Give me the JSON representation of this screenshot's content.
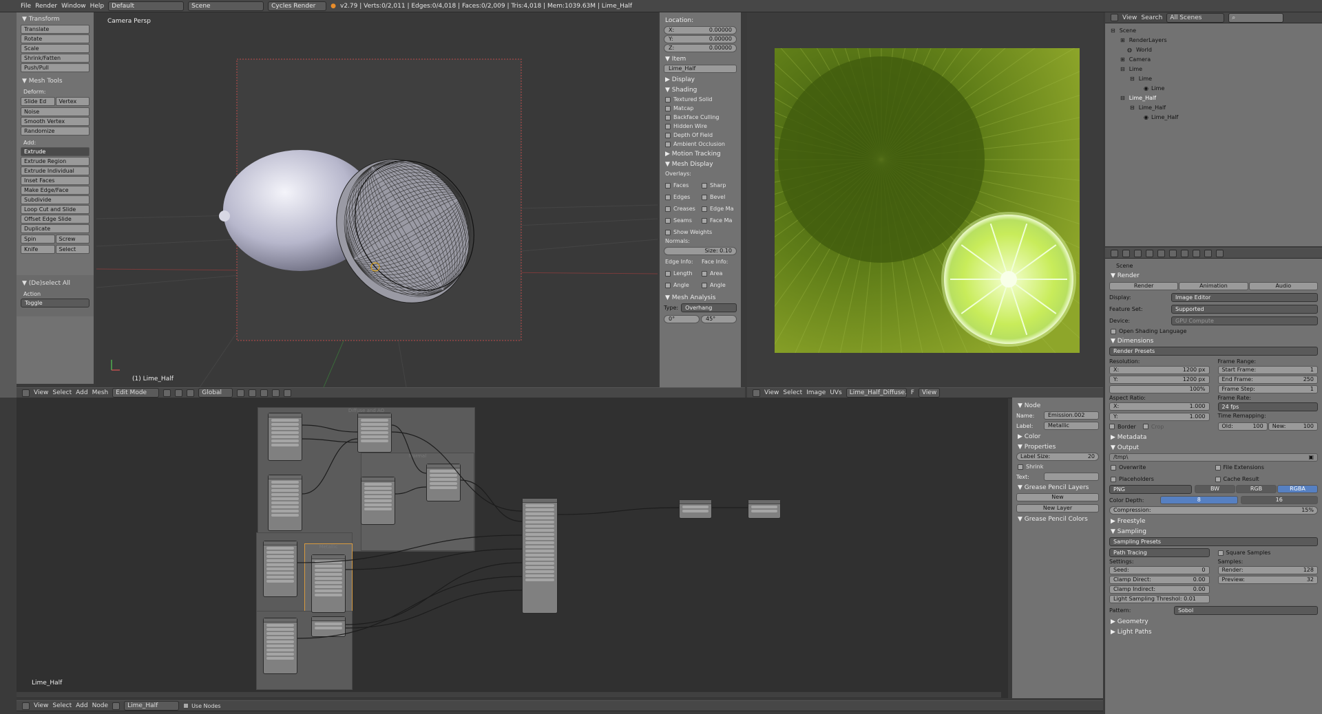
{
  "topbar": {
    "menus": [
      "File",
      "Render",
      "Window",
      "Help"
    ],
    "layout": "Default",
    "scene": "Scene",
    "engine": "Cycles Render",
    "stats": "v2.79 | Verts:0/2,011 | Edges:0/4,018 | Faces:0/2,009 | Tris:4,018 | Mem:1039.63M | Lime_Half"
  },
  "tools": {
    "transform_title": "Transform",
    "transform_buttons": [
      "Translate",
      "Rotate",
      "Scale",
      "Shrink/Fatten",
      "Push/Pull"
    ],
    "mesh_title": "Mesh Tools",
    "deform_label": "Deform:",
    "slide_edge": "Slide Ed",
    "vertex": "Vertex",
    "deform_buttons": [
      "Noise",
      "Smooth Vertex",
      "Randomize"
    ],
    "add_label": "Add:",
    "extrude": "Extrude",
    "add_buttons": [
      "Extrude Region",
      "Extrude Individual",
      "Inset Faces",
      "Make Edge/Face",
      "Subdivide",
      "Loop Cut and Slide",
      "Offset Edge Slide",
      "Duplicate"
    ],
    "spin": "Spin",
    "screw": "Screw",
    "knife": "Knife",
    "select": "Select",
    "deselect_all": "(De)select All",
    "action_label": "Action",
    "action_value": "Toggle"
  },
  "viewport": {
    "title": "Camera Persp",
    "object": "(1) Lime_Half",
    "header_menus": [
      "View",
      "Select",
      "Add",
      "Mesh"
    ],
    "mode": "Edit Mode",
    "orientation": "Global"
  },
  "npanel": {
    "location_title": "Location:",
    "x": "X:",
    "x_val": "0.00000",
    "y": "Y:",
    "y_val": "0.00000",
    "z": "Z:",
    "z_val": "0.00000",
    "item_title": "Item",
    "item_name": "Lime_Half",
    "display": "Display",
    "shading": "Shading",
    "shading_checks": [
      "Textured Solid",
      "Matcap",
      "Backface Culling",
      "Hidden Wire",
      "Depth Of Field",
      "Ambient Occlusion"
    ],
    "motion_tracking": "Motion Tracking",
    "mesh_display": "Mesh Display",
    "overlays": "Overlays:",
    "faces": "Faces",
    "sharp": "Sharp",
    "edges": "Edges",
    "bevel": "Bevel",
    "creases": "Creases",
    "edge_ma": "Edge Ma",
    "seams": "Seams",
    "face_ma": "Face Ma",
    "show_weights": "Show Weights",
    "normals": "Normals:",
    "size": "Size: 0.10",
    "edge_info": "Edge Info:",
    "face_info": "Face Info:",
    "length": "Length",
    "area": "Area",
    "angle1": "Angle",
    "angle2": "Angle",
    "mesh_analysis": "Mesh Analysis",
    "type": "Type:",
    "overhang": "Overhang",
    "deg0": "0°",
    "deg45": "45°"
  },
  "image_header": {
    "menus": [
      "View",
      "Select",
      "Image",
      "UVs"
    ],
    "image": "Lime_Half_Diffuse.p...",
    "f": "F",
    "view": "View"
  },
  "outliner": {
    "menus": [
      "View",
      "Search"
    ],
    "scope": "All Scenes",
    "items": [
      "Scene",
      "RenderLayers",
      "World",
      "Camera",
      "Lime",
      "Lime",
      "Lime",
      "Lime_Half",
      "Lime_Half",
      "Lime_Half"
    ]
  },
  "props": {
    "scene": "Scene",
    "render": "Render",
    "render_btn": "Render",
    "animation_btn": "Animation",
    "audio_btn": "Audio",
    "display_label": "Display:",
    "display_val": "Image Editor",
    "feature_label": "Feature Set:",
    "feature_val": "Supported",
    "device_label": "Device:",
    "device_val": "GPU Compute",
    "osl": "Open Shading Language",
    "dimensions": "Dimensions",
    "render_presets": "Render Presets",
    "resolution": "Resolution:",
    "res_x": "X:",
    "res_x_val": "1200 px",
    "res_y": "Y:",
    "res_y_val": "1200 px",
    "res_pct": "100%",
    "frame_range": "Frame Range:",
    "start_frame": "Start Frame:",
    "start_val": "1",
    "end_frame": "End Frame:",
    "end_val": "250",
    "frame_step": "Frame Step:",
    "step_val": "1",
    "aspect": "Aspect Ratio:",
    "asp_x": "X:",
    "asp_x_val": "1.000",
    "asp_y": "Y:",
    "asp_y_val": "1.000",
    "frame_rate": "Frame Rate:",
    "fps": "24 fps",
    "time_remap": "Time Remapping:",
    "old": "Old:",
    "old_val": "100",
    "new": "New:",
    "new_val": "100",
    "border": "Border",
    "crop": "Crop",
    "metadata": "Metadata",
    "output": "Output",
    "path": "/tmp\\",
    "overwrite": "Overwrite",
    "file_ext": "File Extensions",
    "placeholders": "Placeholders",
    "cache_result": "Cache Result",
    "format": "PNG",
    "bw": "BW",
    "rgb": "RGB",
    "rgba": "RGBA",
    "color_depth": "Color Depth:",
    "depth8": "8",
    "depth16": "16",
    "compression": "Compression:",
    "compression_val": "15%",
    "freestyle": "Freestyle",
    "sampling": "Sampling",
    "sampling_presets": "Sampling Presets",
    "path_tracing": "Path Tracing",
    "square_samples": "Square Samples",
    "settings": "Settings:",
    "samples": "Samples:",
    "seed": "Seed:",
    "seed_val": "0",
    "render_s": "Render:",
    "render_s_val": "128",
    "clamp_direct": "Clamp Direct:",
    "clamp_direct_val": "0.00",
    "preview": "Preview:",
    "preview_val": "32",
    "clamp_indirect": "Clamp Indirect:",
    "clamp_indirect_val": "0.00",
    "light_thresh": "Light Sampling Threshol: 0.01",
    "pattern": "Pattern:",
    "pattern_val": "Sobol",
    "geometry": "Geometry",
    "light_paths": "Light Paths"
  },
  "node_editor": {
    "material": "Lime_Half",
    "menus": [
      "View",
      "Select",
      "Add",
      "Node"
    ],
    "use_nodes": "Use Nodes",
    "frame_label": "Diffuse and AO",
    "normal_label": "Normal",
    "metallic_label": "Metallic"
  },
  "node_side": {
    "node_title": "Node",
    "name_label": "Name:",
    "name_val": "Emission.002",
    "label_label": "Label:",
    "label_val": "Metallic",
    "color": "Color",
    "properties": "Properties",
    "label_size": "Label Size:",
    "label_size_val": "20",
    "shrink": "Shrink",
    "text": "Text:",
    "gp_layers": "Grease Pencil Layers",
    "new": "New",
    "new_layer": "New Layer",
    "gp_colors": "Grease Pencil Colors"
  }
}
